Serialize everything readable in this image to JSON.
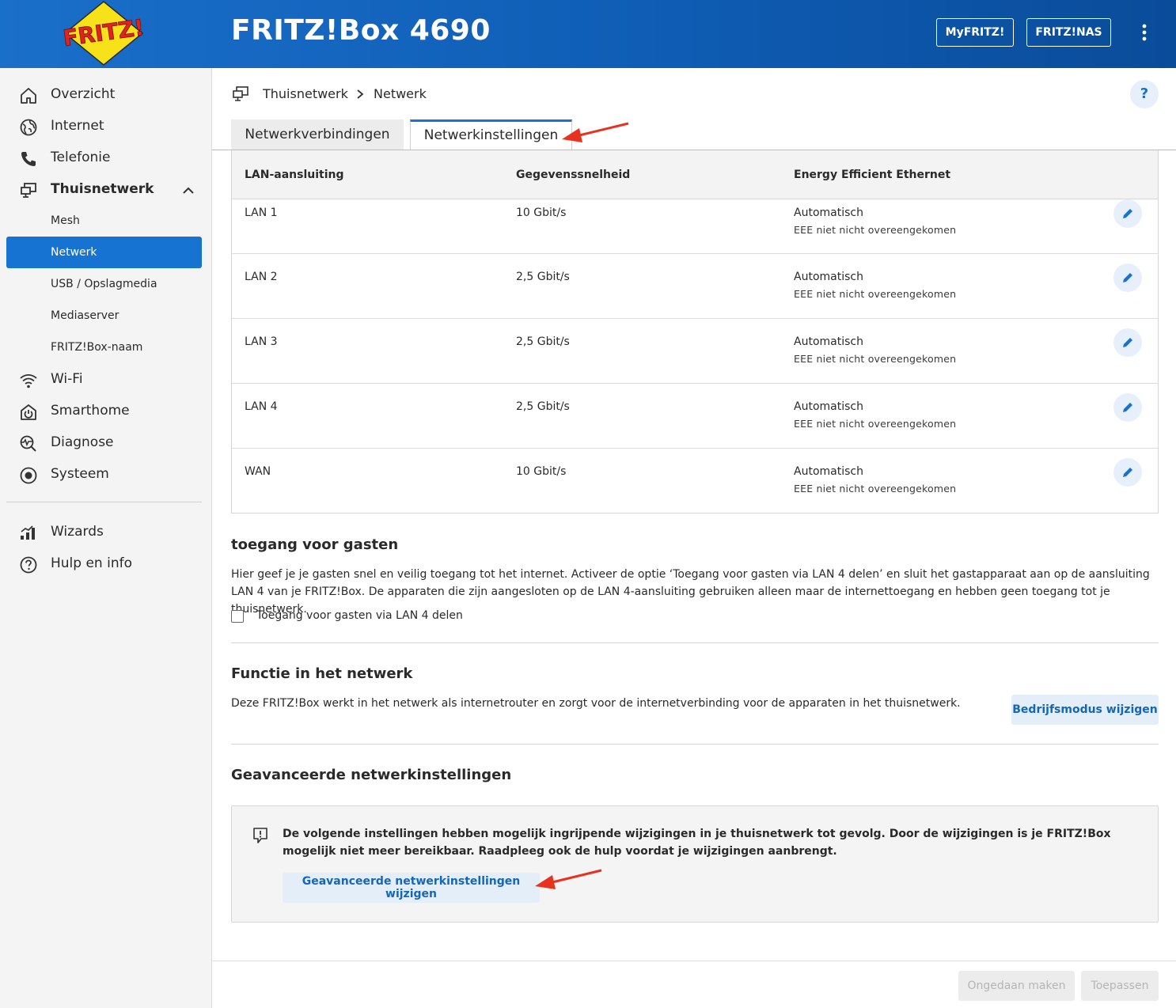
{
  "header": {
    "title": "FRITZ!Box 4690",
    "logo_text": "FRITZ!",
    "myfritz_label": "MyFRITZ!",
    "nas_label": "FRITZ!NAS"
  },
  "sidebar": {
    "items": [
      {
        "label": "Overzicht",
        "icon": "home-icon"
      },
      {
        "label": "Internet",
        "icon": "globe-icon"
      },
      {
        "label": "Telefonie",
        "icon": "phone-icon"
      },
      {
        "label": "Thuisnetwerk",
        "icon": "network-icon"
      },
      {
        "label": "Wi-Fi",
        "icon": "wifi-icon"
      },
      {
        "label": "Smarthome",
        "icon": "smarthome-icon"
      },
      {
        "label": "Diagnose",
        "icon": "diagnose-icon"
      },
      {
        "label": "Systeem",
        "icon": "system-icon"
      }
    ],
    "subitems": [
      {
        "label": "Mesh"
      },
      {
        "label": "Netwerk"
      },
      {
        "label": "USB / Opslagmedia"
      },
      {
        "label": "Mediaserver"
      },
      {
        "label": "FRITZ!Box-naam"
      }
    ],
    "bottom": [
      {
        "label": "Wizards",
        "icon": "wizards-icon"
      },
      {
        "label": "Hulp en info",
        "icon": "help-circle-icon"
      }
    ]
  },
  "breadcrumb": {
    "parent": "Thuisnetwerk",
    "current": "Netwerk"
  },
  "help_label": "?",
  "tabs": [
    {
      "label": "Netwerkverbindingen",
      "active": false
    },
    {
      "label": "Netwerkinstellingen",
      "active": true
    }
  ],
  "table": {
    "headers": [
      "LAN-aansluiting",
      "Gegevenssnelheid",
      "Energy Efficient Ethernet"
    ],
    "rows": [
      {
        "port": "LAN 1",
        "speed": "10 Gbit/s",
        "eee": "Automatisch",
        "eee_status": "EEE niet nicht overeengekomen"
      },
      {
        "port": "LAN 2",
        "speed": "2,5 Gbit/s",
        "eee": "Automatisch",
        "eee_status": "EEE niet nicht overeengekomen"
      },
      {
        "port": "LAN 3",
        "speed": "2,5 Gbit/s",
        "eee": "Automatisch",
        "eee_status": "EEE niet nicht overeengekomen"
      },
      {
        "port": "LAN 4",
        "speed": "2,5 Gbit/s",
        "eee": "Automatisch",
        "eee_status": "EEE niet nicht overeengekomen"
      },
      {
        "port": "WAN",
        "speed": "10 Gbit/s",
        "eee": "Automatisch",
        "eee_status": "EEE niet nicht overeengekomen"
      }
    ]
  },
  "guest": {
    "title": "toegang voor gasten",
    "text": "Hier geef je je gasten snel en veilig toegang tot het internet. Activeer de optie ‘Toegang voor gasten via LAN 4 delen’ en sluit het gastapparaat aan op de aansluiting LAN 4 van je FRITZ!Box. De apparaten die zijn aangesloten op de LAN 4-aansluiting gebruiken alleen maar de internettoegang en hebben geen toegang tot je thuisnetwerk.",
    "checkbox_label": "Toegang voor gasten via LAN 4 delen",
    "checked": false
  },
  "function": {
    "title": "Functie in het netwerk",
    "text": "Deze FRITZ!Box werkt in het netwerk als internetrouter en zorgt voor de internetverbinding voor de apparaten in het thuisnetwerk.",
    "button_label": "Bedrijfsmodus wijzigen"
  },
  "advanced": {
    "title": "Geavanceerde netwerkinstellingen",
    "warning": "De volgende instellingen hebben mogelijk ingrijpende wijzigingen in je thuisnetwerk tot gevolg. Door de wijzigingen is je FRITZ!Box mogelijk niet meer bereikbaar. Raadpleeg ook de hulp voordat je wijzigingen aanbrengt.",
    "button_label": "Geavanceerde netwerkinstellingen wijzigen"
  },
  "footer": {
    "undo_label": "Ongedaan maken",
    "apply_label": "Toepassen"
  },
  "colors": {
    "accent": "#1673d1",
    "header": "#0f5db5",
    "annotation_arrow": "#e8321e"
  }
}
